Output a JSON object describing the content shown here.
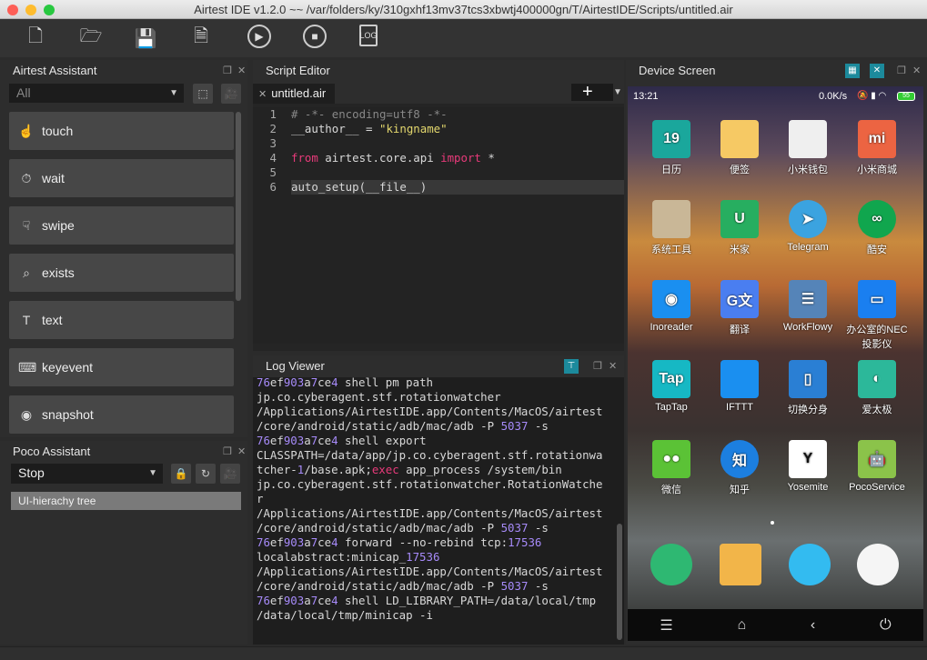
{
  "window": {
    "title": "Airtest IDE v1.2.0 ~~ /var/folders/ky/310gxhf13mv37tcs3xbwtj400000gn/T/AirtestIDE/Scripts/untitled.air"
  },
  "toolbar": {
    "buttons": [
      {
        "name": "new-file-icon",
        "glyph": "🗋"
      },
      {
        "name": "open-folder-icon",
        "glyph": "🗁"
      },
      {
        "name": "save-icon",
        "glyph": "💾"
      },
      {
        "name": "save-as-icon",
        "glyph": "🗎"
      },
      {
        "name": "run-icon",
        "glyph": "▶"
      },
      {
        "name": "stop-icon",
        "glyph": "■"
      },
      {
        "name": "log-icon",
        "glyph": "LOG"
      }
    ]
  },
  "airtest_assistant": {
    "title": "Airtest Assistant",
    "filter_value": "All",
    "items": [
      {
        "label": "touch",
        "icon": "☝"
      },
      {
        "label": "wait",
        "icon": "⏱"
      },
      {
        "label": "swipe",
        "icon": "☟"
      },
      {
        "label": "exists",
        "icon": "⌕"
      },
      {
        "label": "text",
        "icon": "T"
      },
      {
        "label": "keyevent",
        "icon": "⌨"
      },
      {
        "label": "snapshot",
        "icon": "◉"
      }
    ]
  },
  "poco_assistant": {
    "title": "Poco Assistant",
    "mode_value": "Stop",
    "tree_root": "UI-hierachy tree"
  },
  "script_editor": {
    "title": "Script Editor",
    "tab": "untitled.air",
    "lines": [
      [
        {
          "t": "# -*- encoding=utf8 -*-",
          "c": "cm"
        }
      ],
      [
        {
          "t": "__author__ = "
        },
        {
          "t": "\"kingname\"",
          "c": "str"
        }
      ],
      [],
      [
        {
          "t": "from",
          "c": "kw"
        },
        {
          "t": " airtest.core.api "
        },
        {
          "t": "import",
          "c": "kw"
        },
        {
          "t": " *"
        }
      ],
      [],
      [
        {
          "t": "auto_setup(__file__)"
        }
      ]
    ]
  },
  "log_viewer": {
    "title": "Log Viewer",
    "lines": [
      [
        {
          "t": "76",
          "c": "num"
        },
        {
          "t": "ef"
        },
        {
          "t": "903",
          "c": "num"
        },
        {
          "t": "a"
        },
        {
          "t": "7",
          "c": "num"
        },
        {
          "t": "ce"
        },
        {
          "t": "4",
          "c": "num"
        },
        {
          "t": " shell pm path"
        }
      ],
      [
        {
          "t": "jp.co.cyberagent.stf.rotationwatcher"
        }
      ],
      [
        {
          "t": "/Applications/AirtestIDE.app/Contents/MacOS/airtest"
        }
      ],
      [
        {
          "t": "/core/android/static/adb/mac/adb -P "
        },
        {
          "t": "5037",
          "c": "num"
        },
        {
          "t": " -s"
        }
      ],
      [
        {
          "t": "76",
          "c": "num"
        },
        {
          "t": "ef"
        },
        {
          "t": "903",
          "c": "num"
        },
        {
          "t": "a"
        },
        {
          "t": "7",
          "c": "num"
        },
        {
          "t": "ce"
        },
        {
          "t": "4",
          "c": "num"
        },
        {
          "t": " shell export"
        }
      ],
      [
        {
          "t": "CLASSPATH=/data/app/jp.co.cyberagent.stf.rotationwa"
        }
      ],
      [
        {
          "t": "tcher-"
        },
        {
          "t": "1",
          "c": "num"
        },
        {
          "t": "/base.apk;"
        },
        {
          "t": "exec",
          "c": "kw"
        },
        {
          "t": " app_process /system/bin"
        }
      ],
      [
        {
          "t": "jp.co.cyberagent.stf.rotationwatcher.RotationWatche"
        }
      ],
      [
        {
          "t": "r"
        }
      ],
      [
        {
          "t": "/Applications/AirtestIDE.app/Contents/MacOS/airtest"
        }
      ],
      [
        {
          "t": "/core/android/static/adb/mac/adb -P "
        },
        {
          "t": "5037",
          "c": "num"
        },
        {
          "t": " -s"
        }
      ],
      [
        {
          "t": "76",
          "c": "num"
        },
        {
          "t": "ef"
        },
        {
          "t": "903",
          "c": "num"
        },
        {
          "t": "a"
        },
        {
          "t": "7",
          "c": "num"
        },
        {
          "t": "ce"
        },
        {
          "t": "4",
          "c": "num"
        },
        {
          "t": " forward --no-rebind tcp:"
        },
        {
          "t": "17536",
          "c": "num"
        }
      ],
      [
        {
          "t": "localabstract:minicap_"
        },
        {
          "t": "17536",
          "c": "num"
        }
      ],
      [
        {
          "t": "/Applications/AirtestIDE.app/Contents/MacOS/airtest"
        }
      ],
      [
        {
          "t": "/core/android/static/adb/mac/adb -P "
        },
        {
          "t": "5037",
          "c": "num"
        },
        {
          "t": " -s"
        }
      ],
      [
        {
          "t": "76",
          "c": "num"
        },
        {
          "t": "ef"
        },
        {
          "t": "903",
          "c": "num"
        },
        {
          "t": "a"
        },
        {
          "t": "7",
          "c": "num"
        },
        {
          "t": "ce"
        },
        {
          "t": "4",
          "c": "num"
        },
        {
          "t": " shell LD_LIBRARY_PATH=/data/local/tmp"
        }
      ],
      [
        {
          "t": "/data/local/tmp/minicap -i"
        }
      ]
    ]
  },
  "device_screen": {
    "title": "Device Screen",
    "status_time": "13:21",
    "status_right": "0.0K/s",
    "battery": "55",
    "apps": [
      {
        "label": "日历",
        "glyph": "19",
        "color": "#1aa79c"
      },
      {
        "label": "便签",
        "glyph": "",
        "color": "#f6c964"
      },
      {
        "label": "小米钱包",
        "glyph": "",
        "color": "#efefef"
      },
      {
        "label": "小米商城",
        "glyph": "mi",
        "color": "#ec6442"
      },
      {
        "label": "系统工具",
        "glyph": "",
        "color": "#c9b797"
      },
      {
        "label": "米家",
        "glyph": "U",
        "color": "#27ae60"
      },
      {
        "label": "Telegram",
        "glyph": "➤",
        "color": "#3ba3e0"
      },
      {
        "label": "酷安",
        "glyph": "∞",
        "color": "#10a64e"
      },
      {
        "label": "Inoreader",
        "glyph": "◉",
        "color": "#1a8ff0"
      },
      {
        "label": "翻译",
        "glyph": "G文",
        "color": "#4a7ef0"
      },
      {
        "label": "WorkFlowy",
        "glyph": "☰",
        "color": "#5584b8"
      },
      {
        "label": "办公室的NEC投影仪",
        "glyph": "▭",
        "color": "#1a7ff0"
      },
      {
        "label": "TapTap",
        "glyph": "Tap",
        "color": "#16b8c4"
      },
      {
        "label": "IFTTT",
        "glyph": "",
        "color": "#1a8ff0"
      },
      {
        "label": "切换分身",
        "glyph": "▯",
        "color": "#2a7fd4"
      },
      {
        "label": "爱太极",
        "glyph": "◐",
        "color": "#2cb89a"
      },
      {
        "label": "微信",
        "glyph": "●●",
        "color": "#5bc236"
      },
      {
        "label": "知乎",
        "glyph": "知",
        "color": "#1c7fe0"
      },
      {
        "label": "Yosemite",
        "glyph": "Y",
        "color": "#ffffff"
      },
      {
        "label": "PocoService",
        "glyph": "🤖",
        "color": "#8bc34a"
      }
    ],
    "dock": [
      {
        "name": "phone-app",
        "color": "#2eb872"
      },
      {
        "name": "messages-app",
        "color": "#f2b549"
      },
      {
        "name": "browser-app",
        "color": "#33bbf0"
      },
      {
        "name": "camera-app",
        "color": "#f5f5f5"
      }
    ],
    "navbar": [
      {
        "name": "menu-icon",
        "glyph": "☰"
      },
      {
        "name": "home-icon",
        "glyph": "⌂"
      },
      {
        "name": "back-icon",
        "glyph": "‹"
      },
      {
        "name": "power-icon",
        "glyph": "⏻"
      }
    ]
  }
}
